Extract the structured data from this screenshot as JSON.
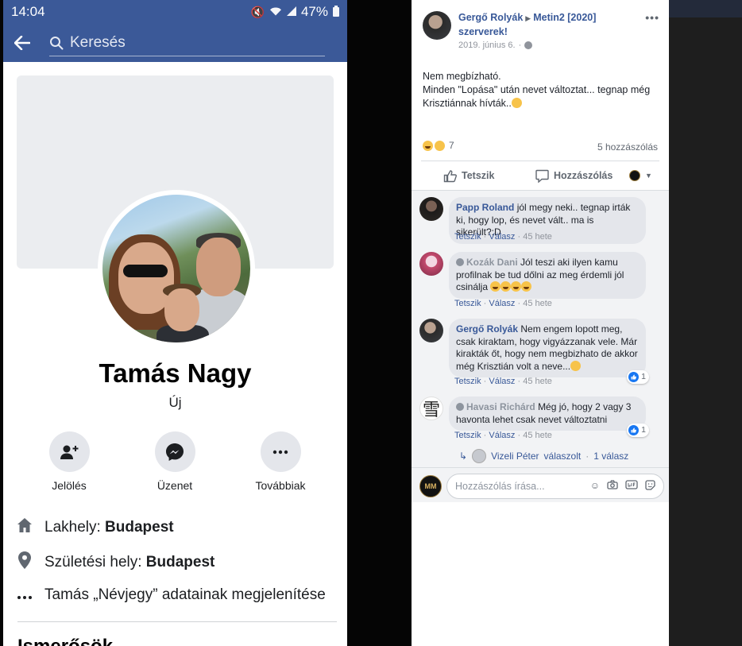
{
  "phone": {
    "status": {
      "time": "14:04",
      "battery": "47%"
    },
    "search": {
      "placeholder": "Keresés"
    },
    "profile": {
      "name": "Tamás Nagy",
      "subtitle": "Új"
    },
    "actions": [
      {
        "label": "Jelölés",
        "icon": "add-friend-icon"
      },
      {
        "label": "Üzenet",
        "icon": "messenger-icon"
      },
      {
        "label": "Továbbiak",
        "icon": "more-icon"
      }
    ],
    "info": {
      "residence_label": "Lakhely: ",
      "residence_value": "Budapest",
      "birthplace_label": "Születési hely: ",
      "birthplace_value": "Budapest",
      "about_text": "Tamás „Névjegy” adatainak megjelenítése"
    },
    "friends_heading": "Ismerősök"
  },
  "post": {
    "author": "Gergő Rolyák",
    "group": "Metin2 [2020] szerverek!",
    "date": "2019. június 6.",
    "body_line1": "Nem megbízható.",
    "body_line2": "Minden \"Lopása\" után nevet változtat... tegnap még Krisztiánnak hívták..",
    "reaction_count": "7",
    "comment_count": "5 hozzászólás",
    "like_label": "Tetszik",
    "comment_label": "Hozzászólás",
    "comments": [
      {
        "author": "Papp Roland",
        "text": "jól megy neki.. tegnap irták ki, hogy lop, és nevet vált.. ma is sikerült?:D",
        "like": "Tetszik",
        "reply": "Válasz",
        "time": "45 hete"
      },
      {
        "author": "Kozák Dani",
        "text": "Jól teszi aki ilyen kamu profilnak be tud dőlni az meg érdemli jól csinálja",
        "like": "Tetszik",
        "reply": "Válasz",
        "time": "45 hete"
      },
      {
        "author": "Gergő Rolyák",
        "text": "Nem engem lopott meg, csak kiraktam, hogy vigyázzanak vele. Már kirakták őt, hogy nem megbizhato de akkor még Krisztián volt a neve...",
        "like": "Tetszik",
        "reply": "Válasz",
        "time": "45 hete",
        "reactions": "1"
      },
      {
        "author": "Havasi Richárd",
        "text": "Még jó, hogy 2 vagy 3 havonta lehet csak nevet változtatni",
        "like": "Tetszik",
        "reply": "Válasz",
        "time": "45 hete",
        "reactions": "1"
      }
    ],
    "replies": {
      "author": "Vizeli Péter",
      "verb": "válaszolt",
      "count": "1 válasz"
    },
    "compose_placeholder": "Hozzászólás írása...",
    "avatar_kanji": "雪",
    "my_avatar_mark": "MM"
  },
  "colors": {
    "fb_blue": "#3b5998",
    "link": "#385898",
    "muted": "#90949c"
  }
}
